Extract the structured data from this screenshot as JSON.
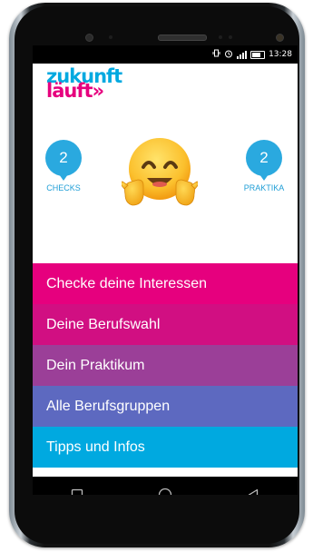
{
  "status_bar": {
    "time": "13:28"
  },
  "logo": {
    "line1": "zukunft",
    "line2": "läuft»",
    "color_top": "#00a9e0",
    "color_bottom": "#e6007e"
  },
  "stats": {
    "checks": {
      "count": "2",
      "label": "CHECKS"
    },
    "praktika": {
      "count": "2",
      "label": "PRAKTIKA"
    }
  },
  "mascot": {
    "icon": "hugging-face-emoji"
  },
  "menu": [
    {
      "label": "Checke deine Interessen",
      "color": "#e6007e"
    },
    {
      "label": "Deine Berufswahl",
      "color": "#d10f82"
    },
    {
      "label": "Dein Praktikum",
      "color": "#9b3f98"
    },
    {
      "label": "Alle Berufsgruppen",
      "color": "#5d69c0"
    },
    {
      "label": "Tipps und Infos",
      "color": "#00a9e0"
    }
  ],
  "navbar": {
    "icons": [
      "recent-apps-icon",
      "home-icon",
      "back-icon"
    ]
  }
}
